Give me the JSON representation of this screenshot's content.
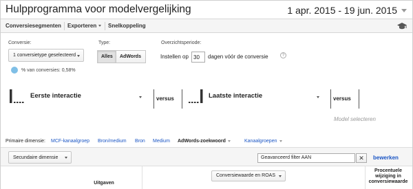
{
  "header": {
    "title": "Hulpprogramma voor modelvergelijking",
    "date_range": "1 apr. 2015 - 19 jun. 2015"
  },
  "toolbar": {
    "conversion_segments": "Conversiesegmenten",
    "export": "Exporteren",
    "shortcut": "Snelkoppeling"
  },
  "settings": {
    "conversion_label": "Conversie:",
    "conversion_value": "1 conversietype geselecteerd",
    "type_label": "Type:",
    "type_all": "Alles",
    "type_adwords": "AdWords",
    "lookback_label": "Overzichtsperiode:",
    "lookback_prefix": "Instellen op",
    "lookback_days": "30",
    "lookback_suffix": "dagen vóór de conversie",
    "help_glyph": "?",
    "conversion_pct": "% van conversies: 0,58%"
  },
  "models": {
    "model1": "Eerste interactie",
    "versus1": "versus",
    "model2": "Laatste interactie",
    "versus2": "versus",
    "model_select": "Model selecteren"
  },
  "dimensions": {
    "label": "Primaire dimensie:",
    "items": [
      "MCF-kanaalgroep",
      "Bron/medium",
      "Bron",
      "Medium"
    ],
    "active": "AdWords-zoekwoord",
    "channel_groups": "Kanaalgroepen"
  },
  "filter": {
    "secondary_dimension": "Secundaire dimensie",
    "advanced_filter": "Geavanceerd filter AAN",
    "clear_glyph": "✕",
    "edit": "bewerken"
  },
  "table": {
    "col_spend": "Uitgaven",
    "col_metric_select": "Conversiewaarde en ROAS",
    "col_pct_change": "Procentuele wijziging in conversiewaarde"
  }
}
